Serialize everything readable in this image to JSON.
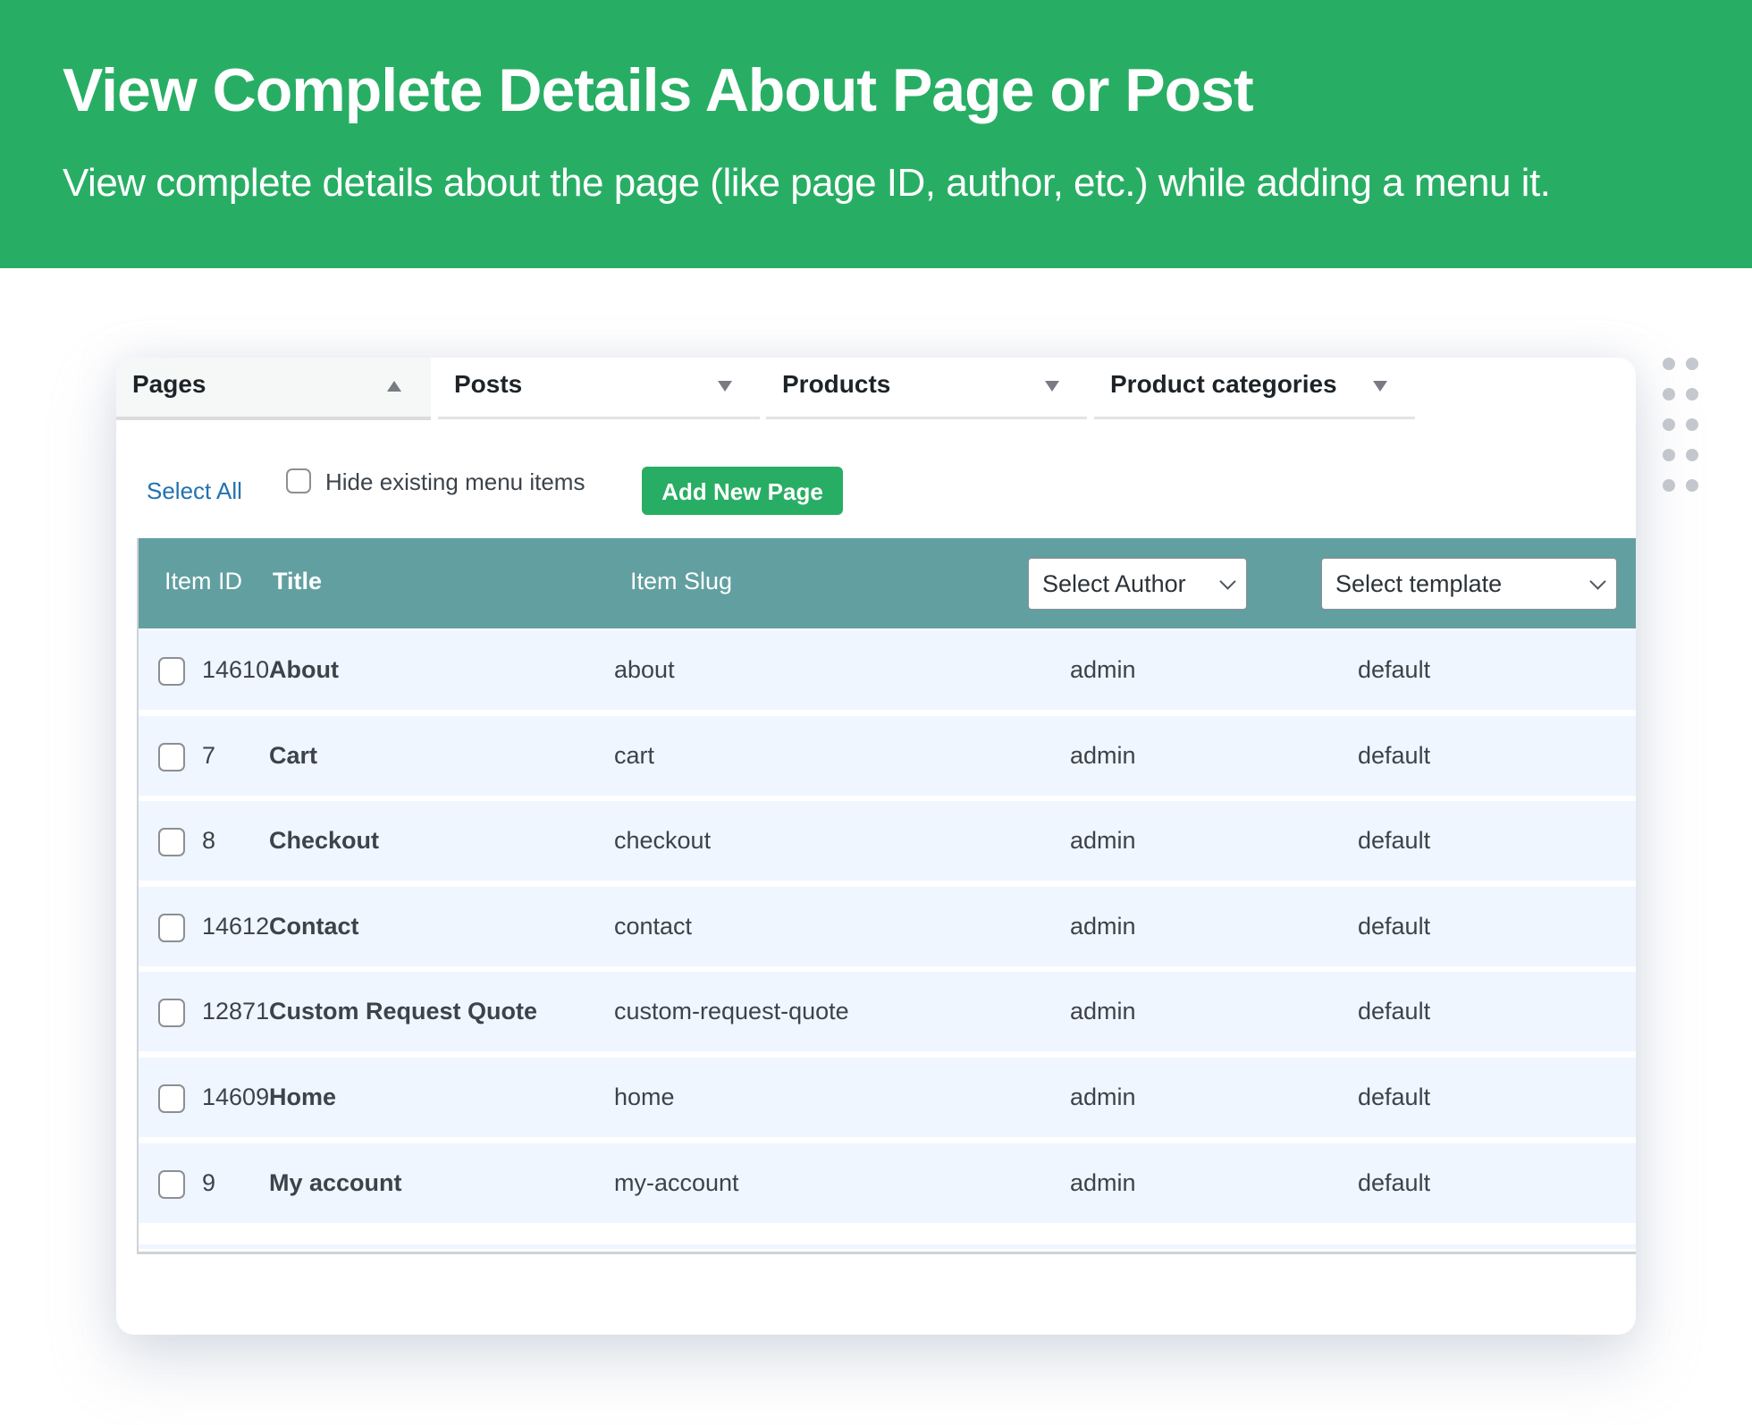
{
  "banner": {
    "title": "View Complete Details About Page or Post",
    "subtitle": "View complete details about the page (like page ID, author, etc.) while adding a menu it."
  },
  "colors": {
    "brand_green": "#28ae64",
    "table_header": "#629fa0",
    "row_bg": "#eff6ff",
    "link_blue": "#2271b1"
  },
  "tabs": [
    {
      "label": "Pages",
      "icon": "caret-up-icon",
      "active": true
    },
    {
      "label": "Posts",
      "icon": "caret-down-icon",
      "active": false
    },
    {
      "label": "Products",
      "icon": "caret-down-icon",
      "active": false
    },
    {
      "label": "Product categories",
      "icon": "caret-down-icon",
      "active": false
    }
  ],
  "toolbar": {
    "select_all": "Select All",
    "hide_existing_label": "Hide existing menu items",
    "hide_existing_checked": false,
    "add_new_label": "Add New Page"
  },
  "table": {
    "headers": {
      "item_id": "Item ID",
      "title": "Title",
      "slug": "Item Slug",
      "author_select": "Select Author",
      "template_select": "Select template"
    },
    "rows": [
      {
        "id": "14610",
        "title": "About",
        "slug": "about",
        "author": "admin",
        "template": "default"
      },
      {
        "id": "7",
        "title": "Cart",
        "slug": "cart",
        "author": "admin",
        "template": "default"
      },
      {
        "id": "8",
        "title": "Checkout",
        "slug": "checkout",
        "author": "admin",
        "template": "default"
      },
      {
        "id": "14612",
        "title": "Contact",
        "slug": "contact",
        "author": "admin",
        "template": "default"
      },
      {
        "id": "12871",
        "title": "Custom Request Quote",
        "slug": "custom-request-quote",
        "author": "admin",
        "template": "default"
      },
      {
        "id": "14609",
        "title": "Home",
        "slug": "home",
        "author": "admin",
        "template": "default"
      },
      {
        "id": "9",
        "title": "My account",
        "slug": "my-account",
        "author": "admin",
        "template": "default"
      }
    ]
  }
}
